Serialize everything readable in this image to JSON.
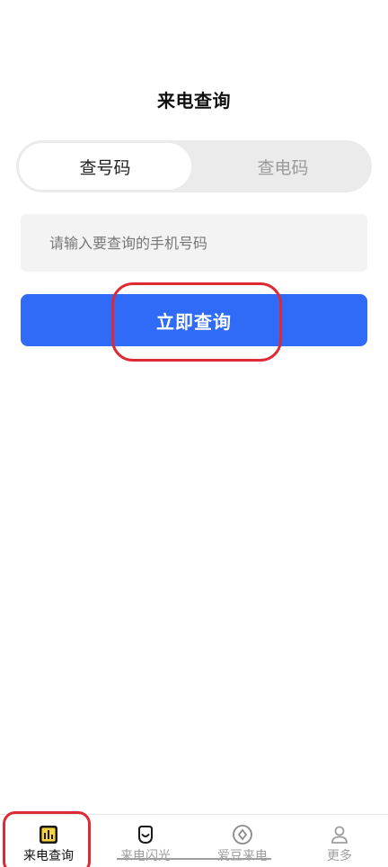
{
  "header": {
    "title": "来电查询"
  },
  "tabs": [
    {
      "label": "查号码",
      "active": true
    },
    {
      "label": "查电码",
      "active": false
    }
  ],
  "search": {
    "placeholder": "请输入要查询的手机号码",
    "value": ""
  },
  "actions": {
    "query_label": "立即查询"
  },
  "bottom_nav": {
    "items": [
      {
        "label": "来电查询",
        "icon": "bar-chart-icon",
        "active": true
      },
      {
        "label": "来电闪光",
        "icon": "smile-icon",
        "active": false
      },
      {
        "label": "爱豆来电",
        "icon": "diamond-circle-icon",
        "active": false
      },
      {
        "label": "更多",
        "icon": "user-icon",
        "active": false
      }
    ]
  },
  "colors": {
    "primary": "#2f6bf6",
    "annotation": "#dd2a35",
    "active_icon": "#f6d33a"
  }
}
